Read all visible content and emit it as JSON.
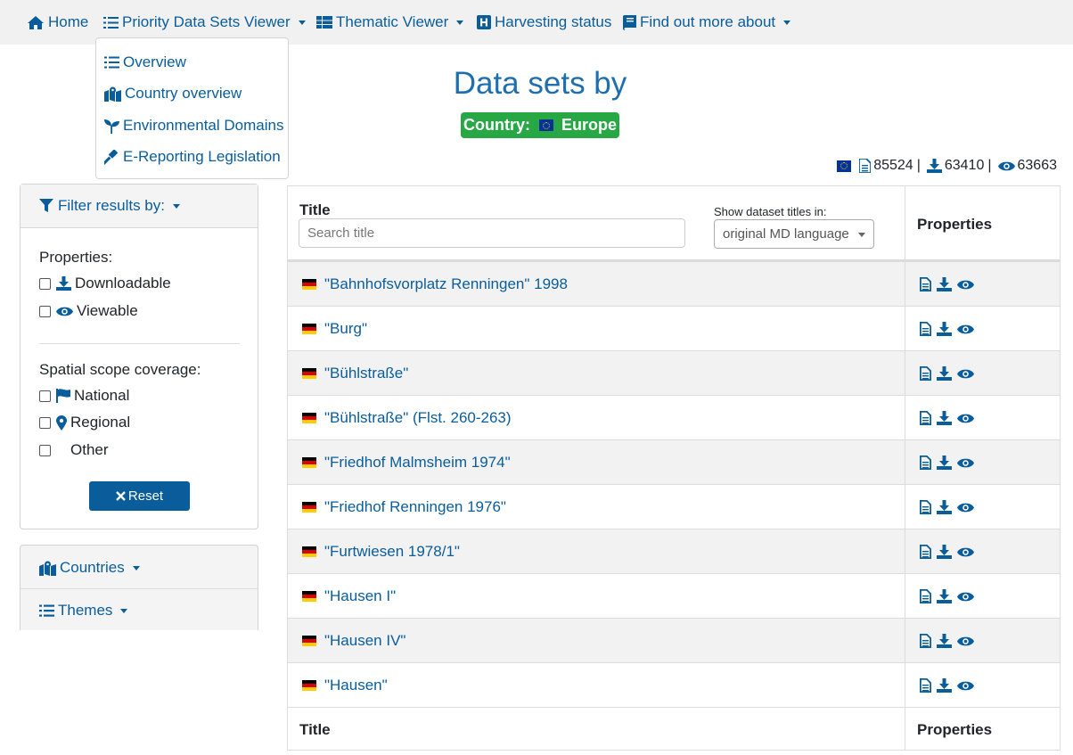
{
  "nav": {
    "home": "Home",
    "priority": "Priority Data Sets Viewer",
    "thematic": "Thematic Viewer",
    "harvesting": "Harvesting status",
    "findout": "Find out more about"
  },
  "dropdown": {
    "overview": "Overview",
    "country_overview": "Country overview",
    "env_domains": "Environmental Domains",
    "ereporting": "E-Reporting Legislation"
  },
  "page": {
    "title": "Data sets by",
    "badge_prefix": "Country:",
    "badge_value": "Europe"
  },
  "stats": {
    "metadata": "85524",
    "downloadable": "63410",
    "viewable": "63663",
    "sep": "|"
  },
  "filter": {
    "header": "Filter results by:",
    "properties_label": "Properties:",
    "downloadable": "Downloadable",
    "viewable": "Viewable",
    "spatial_label": "Spatial scope coverage:",
    "national": "National",
    "regional": "Regional",
    "other": "Other",
    "reset": "Reset"
  },
  "facets": {
    "countries": "Countries",
    "themes": "Themes"
  },
  "table": {
    "col_title": "Title",
    "col_properties": "Properties",
    "search_placeholder": "Search title",
    "lang_label": "Show dataset titles in:",
    "lang_value": "original MD language",
    "rows": [
      {
        "title": "\"Bahnhofsvorplatz Renningen\" 1998",
        "country": "DE"
      },
      {
        "title": "\"Burg\"",
        "country": "DE"
      },
      {
        "title": "\"Bühlstraße\"",
        "country": "DE"
      },
      {
        "title": "\"Bühlstraße\" (Flst. 260-263)",
        "country": "DE"
      },
      {
        "title": "\"Friedhof Malmsheim 1974\"",
        "country": "DE"
      },
      {
        "title": "\"Friedhof Renningen 1976\"",
        "country": "DE"
      },
      {
        "title": "\"Furtwiesen 1978/1\"",
        "country": "DE"
      },
      {
        "title": "\"Hausen I\"",
        "country": "DE"
      },
      {
        "title": "\"Hausen IV\"",
        "country": "DE"
      },
      {
        "title": "\"Hausen\"",
        "country": "DE"
      }
    ]
  },
  "colors": {
    "link": "#0a5d9b",
    "badge": "#28a745",
    "button": "#0a5d9b"
  }
}
